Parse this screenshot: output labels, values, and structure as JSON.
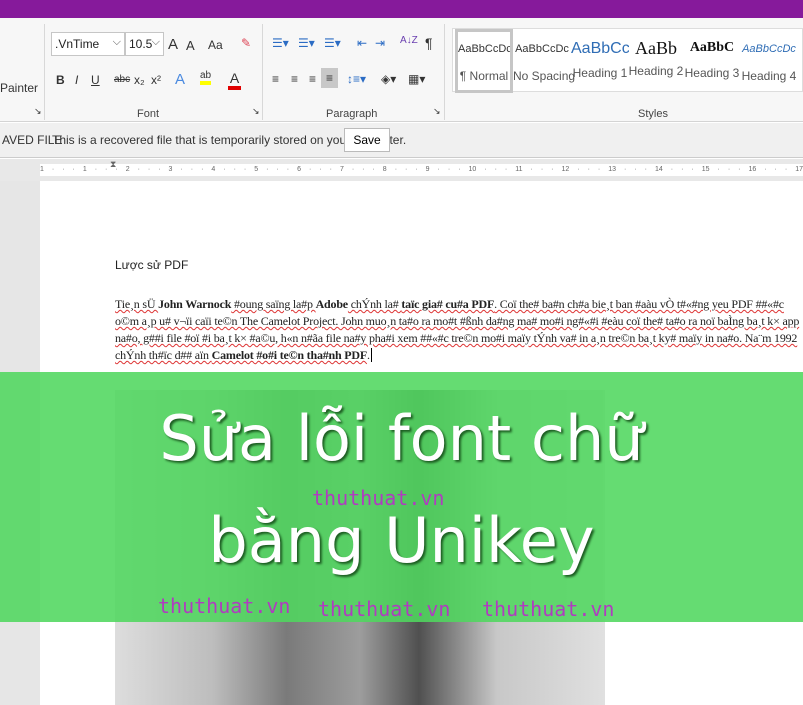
{
  "ribbon": {
    "format_painter": "Painter",
    "font": {
      "name": ".VnTime",
      "size": "10.5",
      "group_label": "Font",
      "bold": "B",
      "italic": "I",
      "underline": "U",
      "strike": "abc",
      "subscript": "x₂",
      "superscript": "x²",
      "change_case": "Aa",
      "grow": "A",
      "shrink": "A",
      "text_effects": "A",
      "highlight": "ab",
      "font_color": "A"
    },
    "paragraph": {
      "group_label": "Paragraph",
      "pilcrow": "¶",
      "sort": "A↓Z"
    },
    "styles": {
      "group_label": "Styles",
      "items": [
        {
          "preview": "AaBbCcDc",
          "name": "¶ Normal"
        },
        {
          "preview": "AaBbCcDc",
          "name": "No Spacing"
        },
        {
          "preview": "AaBbCc",
          "name": "Heading 1"
        },
        {
          "preview": "AaBb",
          "name": "Heading 2"
        },
        {
          "preview": "AaBbC",
          "name": "Heading 3"
        },
        {
          "preview": "AaBbCcDc",
          "name": "Heading 4"
        }
      ]
    },
    "colors": {
      "highlight": "#ffff00",
      "font_color": "#e00000"
    }
  },
  "infobar": {
    "label": "AVED FILE",
    "message": "This is a recovered file that is temporarily stored on your computer.",
    "save": "Save"
  },
  "ruler": {
    "marks": "1 · · · 1 · · · 2 · · · 3 · · · 4 · · · 5 · · · 6 · · · 7 · · · 8 · · · 9 · · · 10 · · · 11 · · · 12 · · · 13 · · · 14 · · · 15 · · · 16 · · · 17"
  },
  "document": {
    "title": "Lược sử PDF",
    "p": [
      "Tie¸n sÜ ",
      "John Warnock",
      " #oung saïng la#p ",
      "Adobe",
      " chÝnh la# ",
      "taïc gia# cu#a PDF",
      ". Coï the# ba#n ch#a bie¸t ban #aàu vÒ t#«#ng yeu PDF ##«#c o©m a¸p u# v¬ïi caïi te©n The Camelot Project.  John muo¸n ta#o ra mo#t #ßnh da#ng ma# mo#i ng#«#i #eàu coï the# ta#o ra noï baÌng ba¸t k× app na#o, g##i file #oï #i ba¸t k× #a©u, h«n n#ãa file na#y pha#i xem ##«#c tre©n mo#i maïy tÝnh va# in a¸n tre©n ba¸t ky# maïy in na#o. Na¨m 1992 chÝnh th#ïc d## aïn ",
      "Camelot #o#i te©n tha#nh PDF",
      "."
    ]
  },
  "overlay": {
    "line1": "Sửa lỗi font chữ",
    "line2": "bằng Unikey",
    "watermark": "thuthuat.vn",
    "color": "#66dd70"
  }
}
